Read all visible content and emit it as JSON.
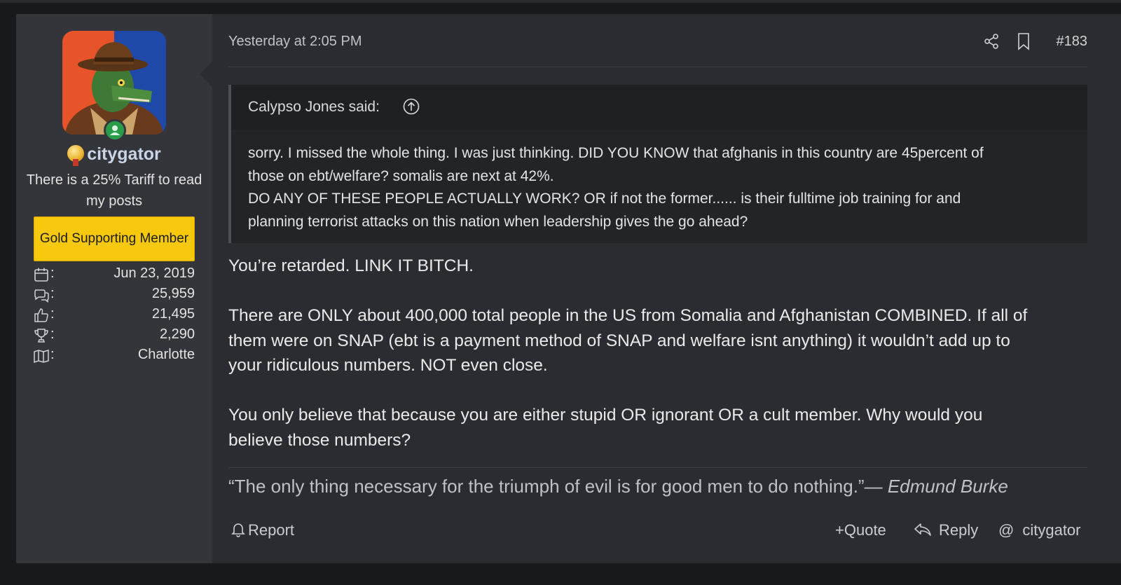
{
  "post": {
    "user": {
      "username": "citygator",
      "title": "There is a 25% Tariff to read my posts",
      "banner": "Gold Supporting Member",
      "stats": [
        {
          "icon": "calendar-icon",
          "value": "Jun 23, 2019"
        },
        {
          "icon": "messages-icon",
          "value": "25,959"
        },
        {
          "icon": "thumbs-up-icon",
          "value": "21,495"
        },
        {
          "icon": "trophy-icon",
          "value": "2,290"
        },
        {
          "icon": "map-icon",
          "value": "Charlotte"
        }
      ],
      "colon": ":"
    },
    "header": {
      "timestamp": "Yesterday at 2:05 PM",
      "post_number": "#183"
    },
    "quote": {
      "author": "Calypso Jones said:",
      "line1": "sorry. I missed the whole thing. I was just thinking. DID YOU KNOW that afghanis in this country are 45percent of",
      "line2": "those on ebt/welfare? somalis are next at 42%.",
      "line3": "DO ANY OF THESE PEOPLE ACTUALLY WORK? OR if not the former...... is their fulltime job training for and",
      "line4": "planning terrorist attacks on this nation when leadership gives the go ahead?"
    },
    "message": {
      "p1": "You’re retarded. LINK IT BITCH.",
      "p2_l1": "There are ONLY about 400,000 total people in the US from Somalia and Afghanistan COMBINED. If all of",
      "p2_l2": "them were on SNAP (ebt is a payment method of SNAP and welfare isnt anything) it wouldn’t add up to",
      "p2_l3": "your ridiculous numbers. NOT even close.",
      "p3_l1": "You only believe that because you are either stupid OR ignorant OR a cult member. Why would you",
      "p3_l2": "believe those numbers?"
    },
    "signature": {
      "quote": "“The only thing necessary for the triumph of evil is for good men to do nothing.”",
      "author": "— Edmund Burke"
    },
    "footer": {
      "report": "Report",
      "quote": "Quote",
      "quote_prefix": "+",
      "reply": "Reply",
      "mention_prefix": "@",
      "mention": "citygator"
    }
  }
}
